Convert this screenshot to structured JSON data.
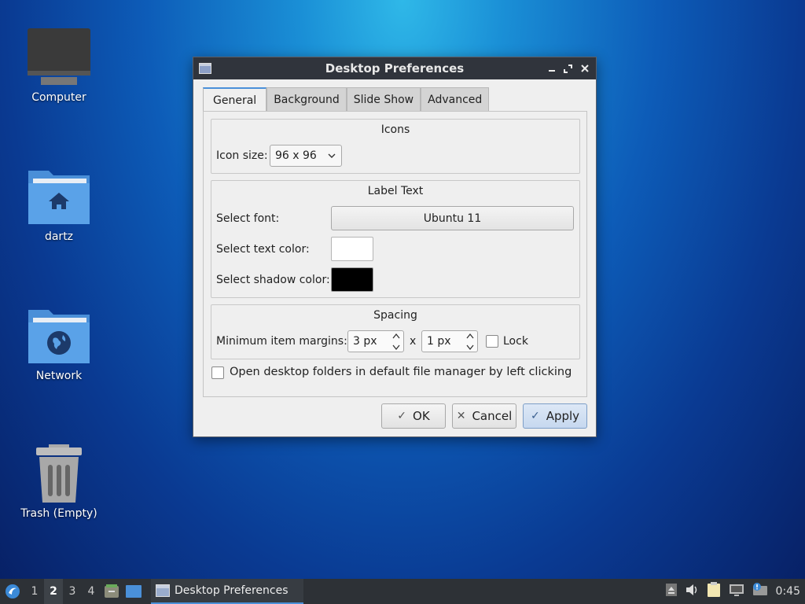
{
  "desktop": {
    "icons": [
      {
        "label": "Computer",
        "icon": "computer-icon"
      },
      {
        "label": "dartz",
        "icon": "home-folder-icon"
      },
      {
        "label": "Network",
        "icon": "network-folder-icon"
      },
      {
        "label": "Trash (Empty)",
        "icon": "trash-icon"
      }
    ]
  },
  "window": {
    "title": "Desktop Preferences",
    "tabs": [
      {
        "label": "General",
        "active": true
      },
      {
        "label": "Background",
        "active": false
      },
      {
        "label": "Slide Show",
        "active": false
      },
      {
        "label": "Advanced",
        "active": false
      }
    ],
    "icons_group": {
      "title": "Icons",
      "icon_size_label": "Icon size:",
      "icon_size_value": "96 x 96"
    },
    "label_text_group": {
      "title": "Label Text",
      "font_label": "Select font:",
      "font_value": "Ubuntu 11",
      "text_color_label": "Select text color:",
      "text_color": "#ffffff",
      "shadow_color_label": "Select shadow color:",
      "shadow_color": "#000000"
    },
    "spacing_group": {
      "title": "Spacing",
      "margins_label": "Minimum item margins:",
      "margin_x": "3 px",
      "separator": "x",
      "margin_y": "1 px",
      "lock_label": "Lock",
      "lock_checked": false
    },
    "open_folders_label": "Open desktop folders in default file manager by left clicking",
    "open_folders_checked": false,
    "buttons": {
      "ok": "OK",
      "cancel": "Cancel",
      "apply": "Apply"
    }
  },
  "taskbar": {
    "workspaces": [
      "1",
      "2",
      "3",
      "4"
    ],
    "active_workspace": "2",
    "task_label": "Desktop Preferences",
    "clock": "0:45"
  },
  "colors": {
    "accent": "#4a90d9",
    "titlebar": "#30343c",
    "taskbar": "#2d3136"
  }
}
